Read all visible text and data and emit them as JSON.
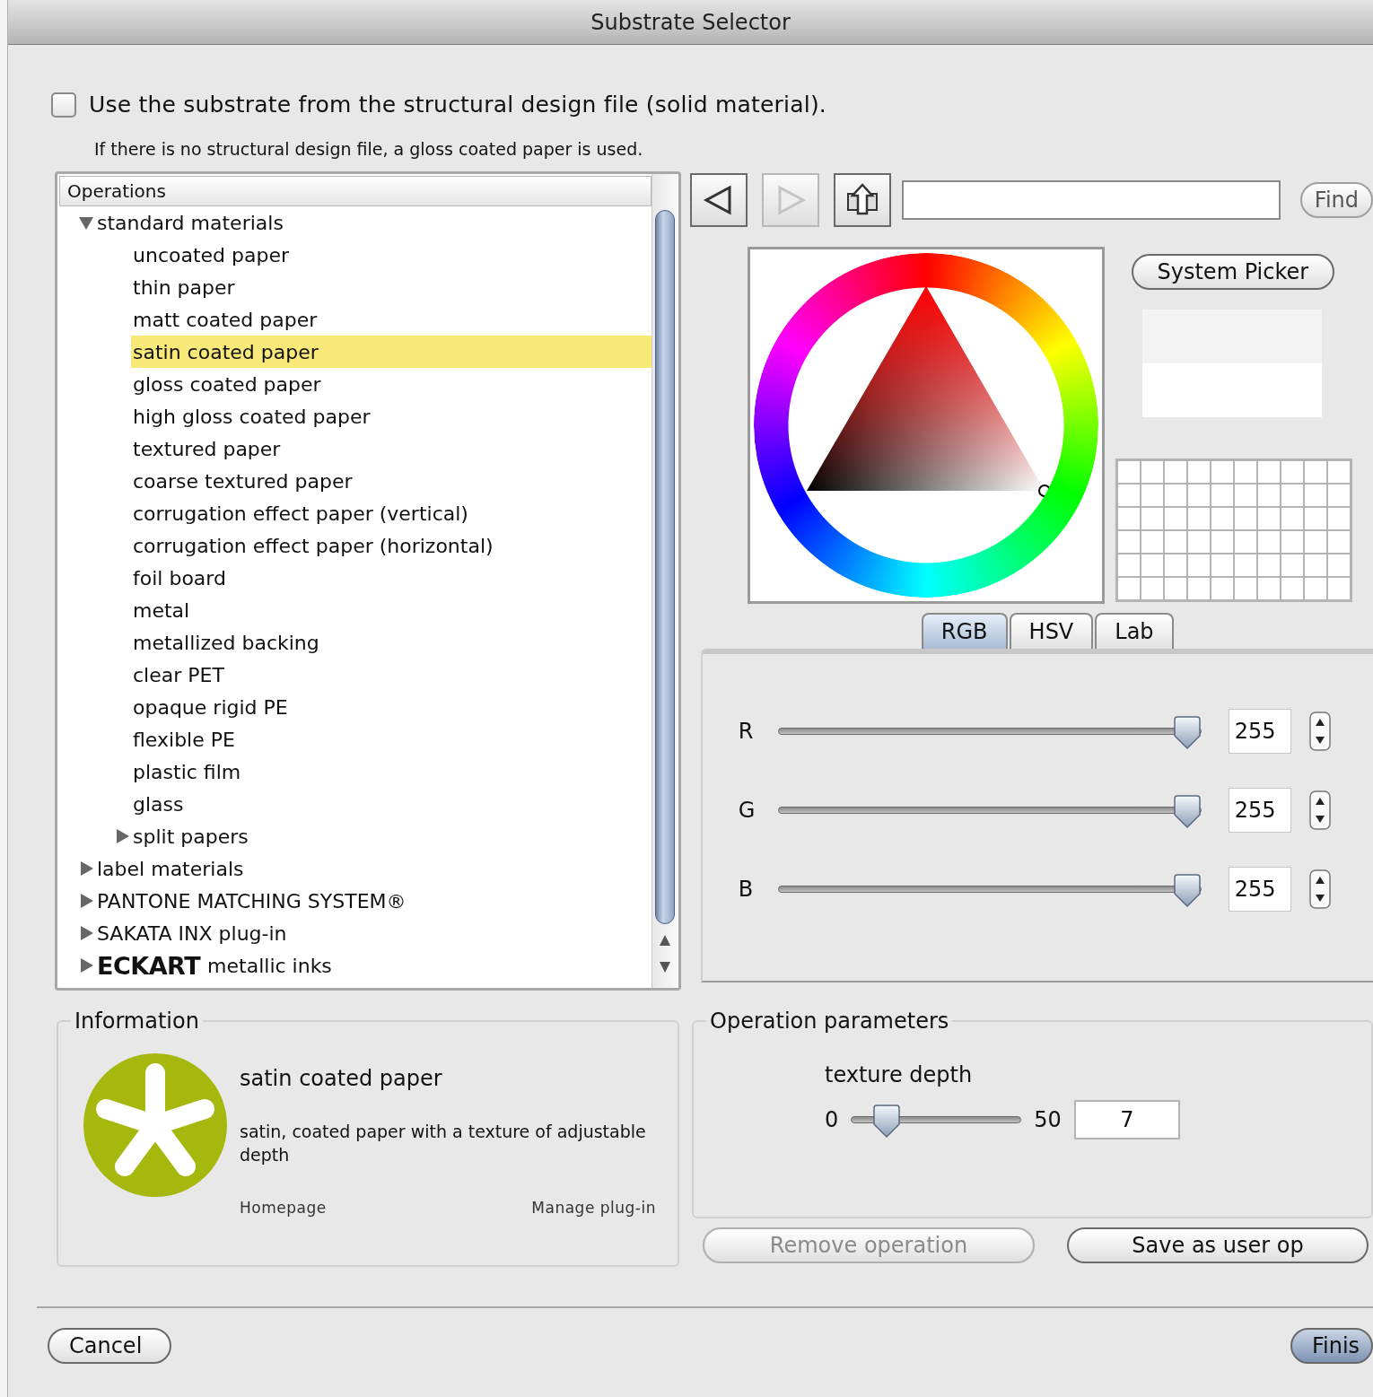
{
  "window": {
    "title": "Substrate Selector"
  },
  "use_structural_substrate": {
    "label": "Use the substrate from the structural design file (solid material).",
    "checked": false
  },
  "hint": "If there is no structural design file, a gloss coated paper is used.",
  "operations_tree": {
    "header": "Operations",
    "items": [
      {
        "label": "standard materials",
        "expanded": true,
        "selected": false,
        "children": [
          {
            "label": "uncoated paper",
            "selected": false
          },
          {
            "label": "thin paper",
            "selected": false
          },
          {
            "label": "matt coated paper",
            "selected": false
          },
          {
            "label": "satin coated paper",
            "selected": true
          },
          {
            "label": "gloss coated paper",
            "selected": false
          },
          {
            "label": "high gloss coated paper",
            "selected": false
          },
          {
            "label": "textured paper",
            "selected": false
          },
          {
            "label": "coarse textured paper",
            "selected": false
          },
          {
            "label": "corrugation effect paper (vertical)",
            "selected": false
          },
          {
            "label": "corrugation effect paper (horizontal)",
            "selected": false
          },
          {
            "label": "foil board",
            "selected": false
          },
          {
            "label": "metal",
            "selected": false
          },
          {
            "label": "metallized backing",
            "selected": false
          },
          {
            "label": "clear PET",
            "selected": false
          },
          {
            "label": "opaque rigid PE",
            "selected": false
          },
          {
            "label": "flexible PE",
            "selected": false
          },
          {
            "label": "plastic film",
            "selected": false
          },
          {
            "label": "glass",
            "selected": false
          },
          {
            "label": "split papers",
            "expanded": false,
            "selected": false
          }
        ]
      },
      {
        "label": "label materials",
        "expanded": false,
        "selected": false
      },
      {
        "label": "PANTONE MATCHING SYSTEM®",
        "expanded": false,
        "selected": false
      },
      {
        "label": "SAKATA INX plug-in",
        "expanded": false,
        "selected": false
      },
      {
        "label": "**ECKART** metallic inks",
        "expanded": false,
        "selected": false
      }
    ]
  },
  "toolbar": {
    "nav_buttons": [
      {
        "kind": "back",
        "disabled": false
      },
      {
        "kind": "forward",
        "disabled": true
      },
      {
        "kind": "upload",
        "disabled": false
      }
    ],
    "find_button": "Find"
  },
  "color_picker": {
    "system_picker_button": "System Picker",
    "tabs": [
      {
        "label": "RGB",
        "selected": true
      },
      {
        "label": "HSV",
        "selected": false
      },
      {
        "label": "Lab",
        "selected": false
      }
    ],
    "channels": [
      {
        "name": "R",
        "level": 1,
        "value": "255"
      },
      {
        "name": "G",
        "level": 1,
        "value": "255"
      },
      {
        "name": "B",
        "level": 1,
        "value": "255"
      }
    ]
  },
  "information": {
    "title": "Information",
    "name": "satin coated paper",
    "description": "satin, coated paper with a texture of adjustable depth",
    "links": [
      "Homepage",
      "Manage plug-in"
    ]
  },
  "operation_parameters": {
    "title": "Operation parameters",
    "label": "texture depth",
    "min": "0",
    "max": "50",
    "level": 0.14,
    "value": "7"
  },
  "buttons": [
    {
      "label": "Remove operation",
      "disabled": true
    },
    {
      "label": "Save as user op",
      "disabled": false
    }
  ],
  "footer_buttons": [
    {
      "label": "Cancel",
      "default": false
    },
    {
      "label": "Finis",
      "default": true
    }
  ]
}
